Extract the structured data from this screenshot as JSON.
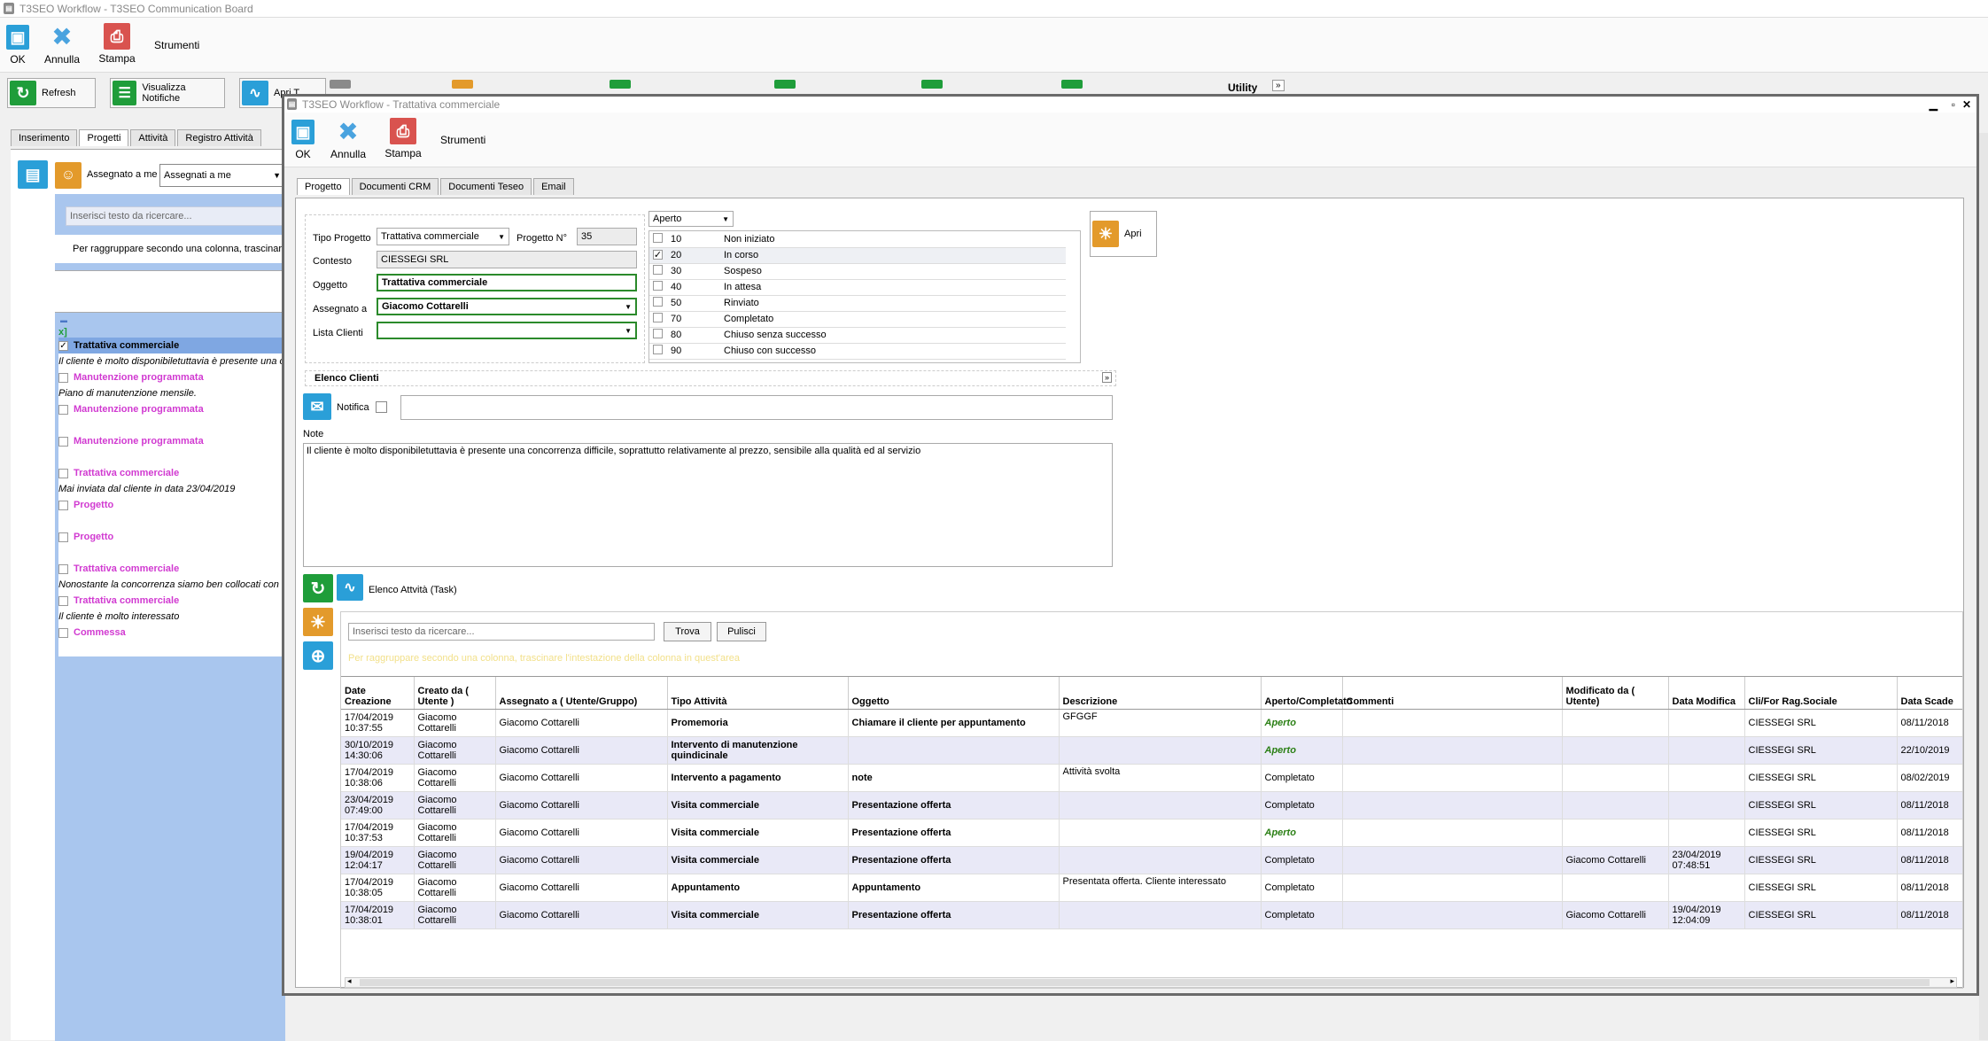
{
  "main_window": {
    "title": "T3SEO Workflow - T3SEO Communication Board"
  },
  "main_toolbar": {
    "ok": "OK",
    "annulla": "Annulla",
    "stampa": "Stampa",
    "strumenti": "Strumenti"
  },
  "main_ribbon": {
    "refresh": "Refresh",
    "visualizza_notifiche": "Visualizza Notifiche",
    "attivita_trunc": "Apri T...",
    "utility": "Utility"
  },
  "main_tabs": [
    "Inserimento",
    "Progetti",
    "Attività",
    "Registro Attività"
  ],
  "left_panel": {
    "assegnato_label": "Assegnato a me",
    "assegnato_value": "Assegnati a me",
    "search_placeholder": "Inserisci testo da ricercare...",
    "group_hint": "Per raggruppare secondo una colonna, trascinare l'",
    "items": [
      {
        "title": "Trattativa commerciale",
        "note": "Il cliente è molto disponibiletuttavia è presente una c",
        "checked": true
      },
      {
        "title": "Manutenzione programmata",
        "note": "Piano di manutenzione mensile."
      },
      {
        "title": "Manutenzione programmata",
        "note": ""
      },
      {
        "title": "Manutenzione programmata",
        "note": ""
      },
      {
        "title": "Trattativa commerciale",
        "note": "Mai inviata dal cliente in data 23/04/2019"
      },
      {
        "title": "Progetto",
        "note": ""
      },
      {
        "title": "Progetto",
        "note": ""
      },
      {
        "title": "Trattativa commerciale",
        "note": "Nonostante la concorrenza siamo ben collocati con il"
      },
      {
        "title": "Trattativa commerciale",
        "note": "Il cliente è molto interessato"
      },
      {
        "title": "Commessa",
        "note": ""
      }
    ]
  },
  "dialog": {
    "title": "T3SEO Workflow - Trattativa commerciale",
    "toolbar": {
      "ok": "OK",
      "annulla": "Annulla",
      "stampa": "Stampa",
      "strumenti": "Strumenti"
    },
    "tabs": [
      "Progetto",
      "Documenti CRM",
      "Documenti Teseo",
      "Email"
    ],
    "form": {
      "tipo_label": "Tipo Progetto",
      "tipo_value": "Trattativa commerciale",
      "num_label": "Progetto N°",
      "num_value": "35",
      "contesto_label": "Contesto",
      "contesto_value": "CIESSEGI SRL",
      "oggetto_label": "Oggetto",
      "oggetto_value": "Trattativa commerciale",
      "assegnato_label": "Assegnato a",
      "assegnato_value": "Giacomo Cottarelli",
      "lista_label": "Lista Clienti",
      "lista_value": ""
    },
    "status_select": "Aperto",
    "statuses": [
      {
        "code": "10",
        "label": "Non iniziato",
        "checked": false
      },
      {
        "code": "20",
        "label": "In corso",
        "checked": true
      },
      {
        "code": "30",
        "label": "Sospeso",
        "checked": false
      },
      {
        "code": "40",
        "label": "In attesa",
        "checked": false
      },
      {
        "code": "50",
        "label": "Rinviato",
        "checked": false
      },
      {
        "code": "70",
        "label": "Completato",
        "checked": false
      },
      {
        "code": "80",
        "label": "Chiuso senza successo",
        "checked": false
      },
      {
        "code": "90",
        "label": "Chiuso con successo",
        "checked": false
      }
    ],
    "apri": "Apri",
    "elenco_clienti": "Elenco Clienti",
    "notifica": "Notifica",
    "note_label": "Note",
    "note_text": "Il cliente è molto disponibiletuttavia è presente una concorrenza difficile, soprattutto relativamente al prezzo, sensibile alla qualità ed al servizio",
    "elenco_attivita": "Elenco Attvità (Task)",
    "search_placeholder": "Inserisci testo da ricercare...",
    "trova": "Trova",
    "pulisci": "Pulisci",
    "group_hint": "Per raggruppare secondo una colonna, trascinare l'intestazione della colonna in quest'area",
    "grid": {
      "headers": [
        "Date Creazione",
        "Creato da ( Utente )",
        "Assegnato a ( Utente/Gruppo)",
        "Tipo Attività",
        "Oggetto",
        "Descrizione",
        "Aperto/Completato",
        "Commenti",
        "Modificato da ( Utente)",
        "Data Modifica",
        "Cli/For Rag.Sociale",
        "Data Scade"
      ],
      "rows": [
        [
          "17/04/2019 10:37:55",
          "Giacomo Cottarelli",
          "Giacomo Cottarelli",
          "Promemoria",
          "Chiamare il cliente per appuntamento",
          "GFGGF",
          "Aperto",
          "",
          "",
          "",
          "CIESSEGI SRL",
          "08/11/2018"
        ],
        [
          "30/10/2019 14:30:06",
          "Giacomo Cottarelli",
          "Giacomo Cottarelli",
          "Intervento di manutenzione quindicinale",
          "",
          "",
          "Aperto",
          "",
          "",
          "",
          "CIESSEGI SRL",
          "22/10/2019"
        ],
        [
          "17/04/2019 10:38:06",
          "Giacomo Cottarelli",
          "Giacomo Cottarelli",
          "Intervento a pagamento",
          "note",
          "Attività svolta",
          "Completato",
          "",
          "",
          "",
          "CIESSEGI SRL",
          "08/02/2019"
        ],
        [
          "23/04/2019 07:49:00",
          "Giacomo Cottarelli",
          "Giacomo Cottarelli",
          "Visita commerciale",
          "Presentazione offerta",
          "",
          "Completato",
          "",
          "",
          "",
          "CIESSEGI SRL",
          "08/11/2018"
        ],
        [
          "17/04/2019 10:37:53",
          "Giacomo Cottarelli",
          "Giacomo Cottarelli",
          "Visita commerciale",
          "Presentazione offerta",
          "",
          "Aperto",
          "",
          "",
          "",
          "CIESSEGI SRL",
          "08/11/2018"
        ],
        [
          "19/04/2019 12:04:17",
          "Giacomo Cottarelli",
          "Giacomo Cottarelli",
          "Visita commerciale",
          "Presentazione offerta",
          "",
          "Completato",
          "",
          "Giacomo Cottarelli",
          "23/04/2019 07:48:51",
          "CIESSEGI SRL",
          "08/11/2018"
        ],
        [
          "17/04/2019 10:38:05",
          "Giacomo Cottarelli",
          "Giacomo Cottarelli",
          "Appuntamento",
          "Appuntamento",
          "Presentata offerta. Cliente interessato",
          "Completato",
          "",
          "",
          "",
          "CIESSEGI SRL",
          "08/11/2018"
        ],
        [
          "17/04/2019 10:38:01",
          "Giacomo Cottarelli",
          "Giacomo Cottarelli",
          "Visita commerciale",
          "Presentazione offerta",
          "",
          "Completato",
          "",
          "Giacomo Cottarelli",
          "19/04/2019 12:04:09",
          "CIESSEGI SRL",
          "08/11/2018"
        ]
      ]
    }
  }
}
